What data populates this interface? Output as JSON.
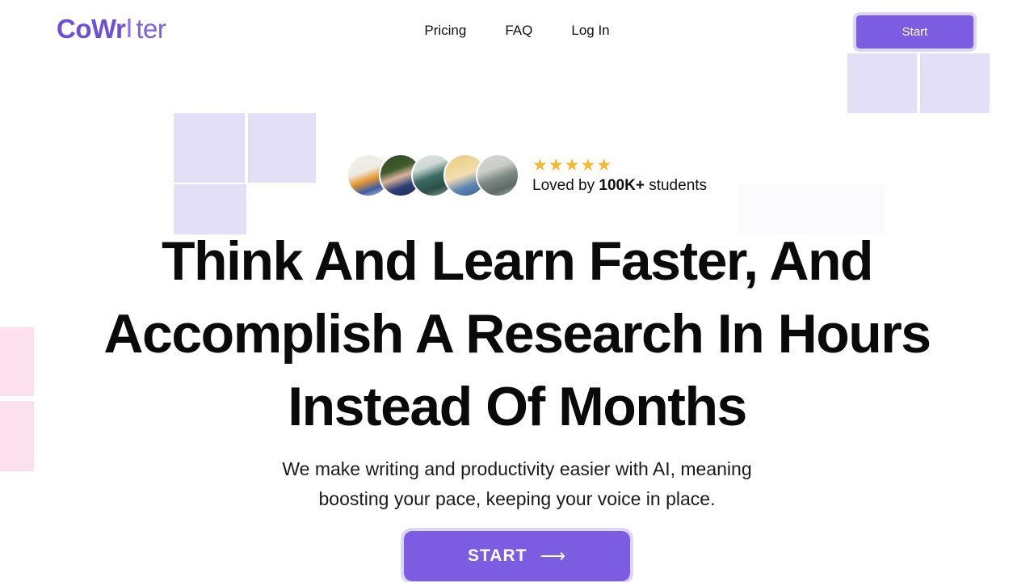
{
  "brand": {
    "logo_bold": "CoWr",
    "logo_caret": "I",
    "logo_rest": "ter",
    "accent_color": "#7c5ce0",
    "accent_ring_color": "#ddd5f7",
    "star_color": "#f5b82e"
  },
  "nav": {
    "items": [
      {
        "label": "Pricing"
      },
      {
        "label": "FAQ"
      },
      {
        "label": "Log In"
      }
    ],
    "cta_label": "Start"
  },
  "hero": {
    "social_proof": {
      "stars": "★★★★★",
      "star_count": 5,
      "loved_prefix": "Loved by ",
      "loved_count": "100K+",
      "loved_suffix": " students",
      "avatars": [
        {
          "name": "student-avatar-1"
        },
        {
          "name": "student-avatar-2"
        },
        {
          "name": "student-avatar-3"
        },
        {
          "name": "student-avatar-4"
        },
        {
          "name": "student-avatar-5"
        }
      ]
    },
    "headline_lines": [
      "Think And Learn Faster, And",
      "Accomplish A Research In Hours",
      "Instead Of Months"
    ],
    "subhead_lines": [
      "We make writing and productivity easier with AI, meaning",
      "boosting your pace, keeping your voice in place."
    ],
    "cta_label": "START",
    "cta_arrow": "⟶"
  },
  "decor": {
    "lavender_color": "#e3dff6",
    "pink_color": "#fde0ee"
  }
}
